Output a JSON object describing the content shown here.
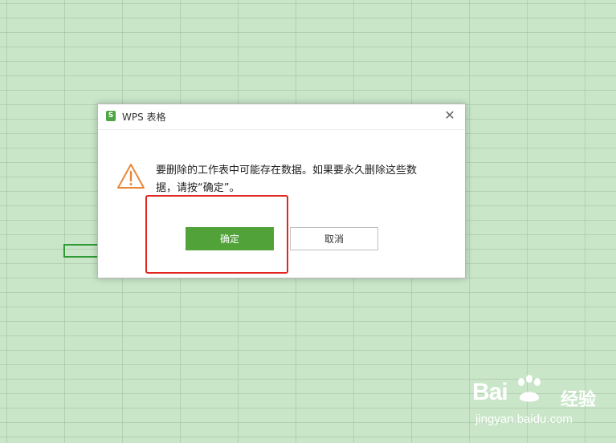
{
  "dialog": {
    "title": "WPS 表格",
    "app_icon_letter": "S",
    "close_glyph": "✕",
    "message_line1": "要删除的工作表中可能存在数据。如果要永久删除这些数",
    "message_line2": "据，请按“确定”。",
    "ok_label": "确定",
    "cancel_label": "取消"
  },
  "watermark": {
    "brand_prefix": "Bai",
    "brand_suffix": "经验",
    "url": "jingyan.baidu.com"
  },
  "colors": {
    "sheet_background": "#c9e6c9",
    "ok_button": "#52a23a",
    "highlight": "#e0261f",
    "selection": "#2f9a36",
    "warning_icon": "#e8873a"
  }
}
